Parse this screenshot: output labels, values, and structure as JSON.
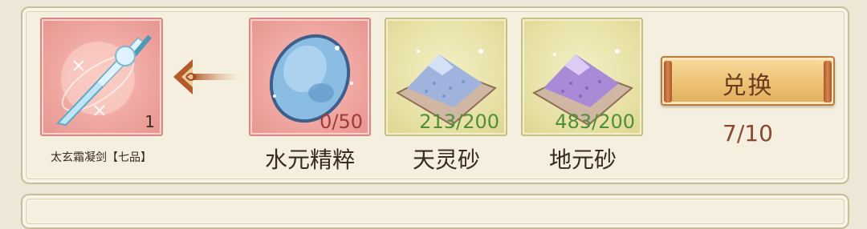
{
  "reward": {
    "name": "太玄霜凝剑【七品】",
    "quantity": "1",
    "icon": "ice-sword-icon"
  },
  "arrow_icon": "arrow-left-icon",
  "materials": [
    {
      "name": "水元精粹",
      "count": "0/50",
      "count_color": "#a13a3a",
      "icon": "water-essence-icon",
      "tile": "red"
    },
    {
      "name": "天灵砂",
      "count": "213/200",
      "count_color": "#4f8f3a",
      "icon": "sky-sand-icon",
      "tile": "yellow"
    },
    {
      "name": "地元砂",
      "count": "483/200",
      "count_color": "#4f8f3a",
      "icon": "earth-sand-icon",
      "tile": "yellow"
    }
  ],
  "exchange": {
    "label": "兑换",
    "remaining": "7/10"
  }
}
